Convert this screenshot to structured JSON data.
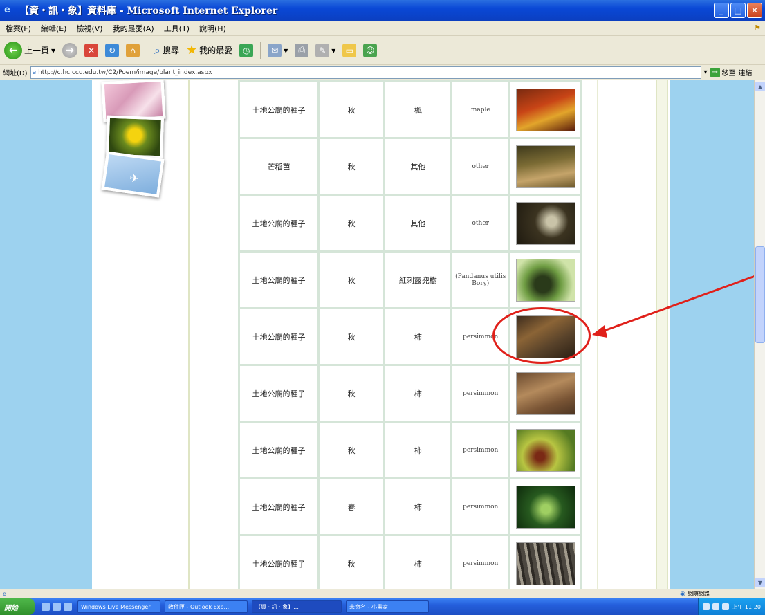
{
  "window": {
    "title": "【資・訊・象】資料庫 - Microsoft Internet Explorer",
    "minimize": "_",
    "maximize": "□",
    "close": "✕"
  },
  "menu": [
    "檔案(F)",
    "編輯(E)",
    "檢視(V)",
    "我的最愛(A)",
    "工具(T)",
    "說明(H)"
  ],
  "toolbar": {
    "back": "上一頁",
    "search": "搜尋",
    "favorites": "我的最愛"
  },
  "address": {
    "label": "網址(D)",
    "url": "http://c.hc.ccu.edu.tw/C2/Poem/image/plant_index.aspx",
    "go": "移至",
    "links": "連結"
  },
  "table": {
    "rows": [
      {
        "c1": "土地公廟的種子",
        "c2": "秋",
        "c3": "楓",
        "c4": "maple",
        "thumb": "thumb-1"
      },
      {
        "c1": "芒稻芭",
        "c2": "秋",
        "c3": "其他",
        "c4": "other",
        "thumb": "thumb-2"
      },
      {
        "c1": "土地公廟的種子",
        "c2": "秋",
        "c3": "其他",
        "c4": "other",
        "thumb": "thumb-3"
      },
      {
        "c1": "土地公廟的種子",
        "c2": "秋",
        "c3": "紅刺露兜樹",
        "c4": "(Pandanus utilis Bory)",
        "thumb": "thumb-4"
      },
      {
        "c1": "土地公廟的種子",
        "c2": "秋",
        "c3": "柿",
        "c4": "persimmon",
        "thumb": "thumb-5"
      },
      {
        "c1": "土地公廟的種子",
        "c2": "秋",
        "c3": "柿",
        "c4": "persimmon",
        "thumb": "thumb-6"
      },
      {
        "c1": "土地公廟的種子",
        "c2": "秋",
        "c3": "柿",
        "c4": "persimmon",
        "thumb": "thumb-7"
      },
      {
        "c1": "土地公廟的種子",
        "c2": "春",
        "c3": "柿",
        "c4": "persimmon",
        "thumb": "thumb-8"
      },
      {
        "c1": "土地公廟的種子",
        "c2": "秋",
        "c3": "柿",
        "c4": "persimmon",
        "thumb": "thumb-9"
      }
    ]
  },
  "status": {
    "zone": "網際網路"
  },
  "taskbar": {
    "start": "開始",
    "tasks": [
      "Windows Live Messenger",
      "收件匣 - Outlook Exp...",
      "【資 · 訊 · 象】...",
      "未命名 - 小畫家"
    ],
    "clock": "上午 11:20"
  },
  "colors": {
    "annotation": "#e0201a",
    "page_bg": "#9dd2ef",
    "table_border": "#d5e5d8"
  }
}
